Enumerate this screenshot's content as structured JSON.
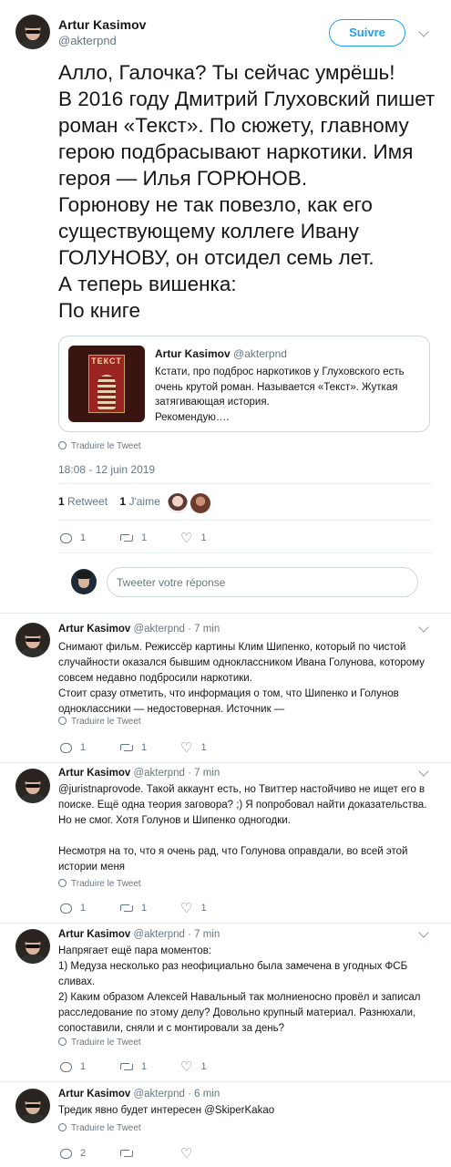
{
  "main_tweet": {
    "author_name": "Artur Kasimov",
    "author_handle": "@akterpnd",
    "follow_label": "Suivre",
    "text": "Алло, Галочка? Ты сейчас умрёшь!\nВ 2016 году Дмитрий Глуховский пишет роман «Текст». По сюжету, главному герою подбрасывают наркотики. Имя героя — Илья ГОРЮНОВ.\nГорюнову не так повезло, как его существующему коллеге Ивану ГОЛУНОВУ, он отсидел семь лет.\nА теперь вишенка:\nПо книге",
    "quote": {
      "author_name": "Artur Kasimov",
      "author_handle": "@akterpnd",
      "text": "Кстати, про подброс наркотиков у Глуховского есть очень крутой роман. Называется «Текст». Жуткая затягивающая история.\nРекомендую….",
      "cover_title": "ТЕКСТ"
    },
    "translate_label": "Traduire le Tweet",
    "datetime": "18:08 - 12 juin 2019",
    "retweets_count": "1",
    "retweets_label": "Retweet",
    "likes_count": "1",
    "likes_label": "J'aime",
    "actions": {
      "replies": "1",
      "retweets": "1",
      "likes": "1"
    },
    "reply_placeholder": "Tweeter votre réponse"
  },
  "replies": [
    {
      "author_name": "Artur Kasimov",
      "author_handle": "@akterpnd",
      "time": "7 min",
      "text": "Снимают фильм. Режиссёр картины Клим Шипенко, который по чистой случайности оказался бывшим одноклассником Ивана Голунова, которому совсем недавно подбросили наркотики.\nСтоит сразу отметить, что информация о том, что Шипенко и Голунов одноклассники — недостоверная. Источник —",
      "translate_label": "Traduire le Tweet",
      "actions": {
        "replies": "1",
        "retweets": "1",
        "likes": "1"
      }
    },
    {
      "author_name": "Artur Kasimov",
      "author_handle": "@akterpnd",
      "time": "7 min",
      "text": "@juristnaprovode. Такой аккаунт есть, но Твиттер настойчиво не ищет его в поиске. Ещё одна теория заговора? ;) Я попробовал найти доказательства. Но не смог. Хотя Голунов и Шипенко одногодки.\n\nНесмотря на то, что я очень рад, что Голунова оправдали, во всей этой истории меня",
      "translate_label": "Traduire le Tweet",
      "actions": {
        "replies": "1",
        "retweets": "1",
        "likes": "1"
      }
    },
    {
      "author_name": "Artur Kasimov",
      "author_handle": "@akterpnd",
      "time": "7 min",
      "text": "Напрягает ещё пара моментов:\n1) Медуза несколько раз неофициально была замечена в угодных ФСБ сливах.\n2) Каким образом Алексей Навальный так молниеносно провёл и записал расследование по этому делу? Довольно крупный материал. Разнюхали, сопоставили, сняли и с монтировали за день?",
      "translate_label": "Traduire le Tweet",
      "actions": {
        "replies": "1",
        "retweets": "1",
        "likes": "1"
      }
    },
    {
      "author_name": "Artur Kasimov",
      "author_handle": "@akterpnd",
      "time": "6 min",
      "text": "Тредик явно будет интересен @SkiperKakao",
      "translate_label": "Traduire le Tweet",
      "actions": {
        "replies": "2",
        "retweets": "",
        "likes": ""
      }
    }
  ],
  "colors": {
    "accent": "#1da1f2",
    "text": "#14171a",
    "muted": "#657786",
    "border": "#e6ecf0"
  }
}
